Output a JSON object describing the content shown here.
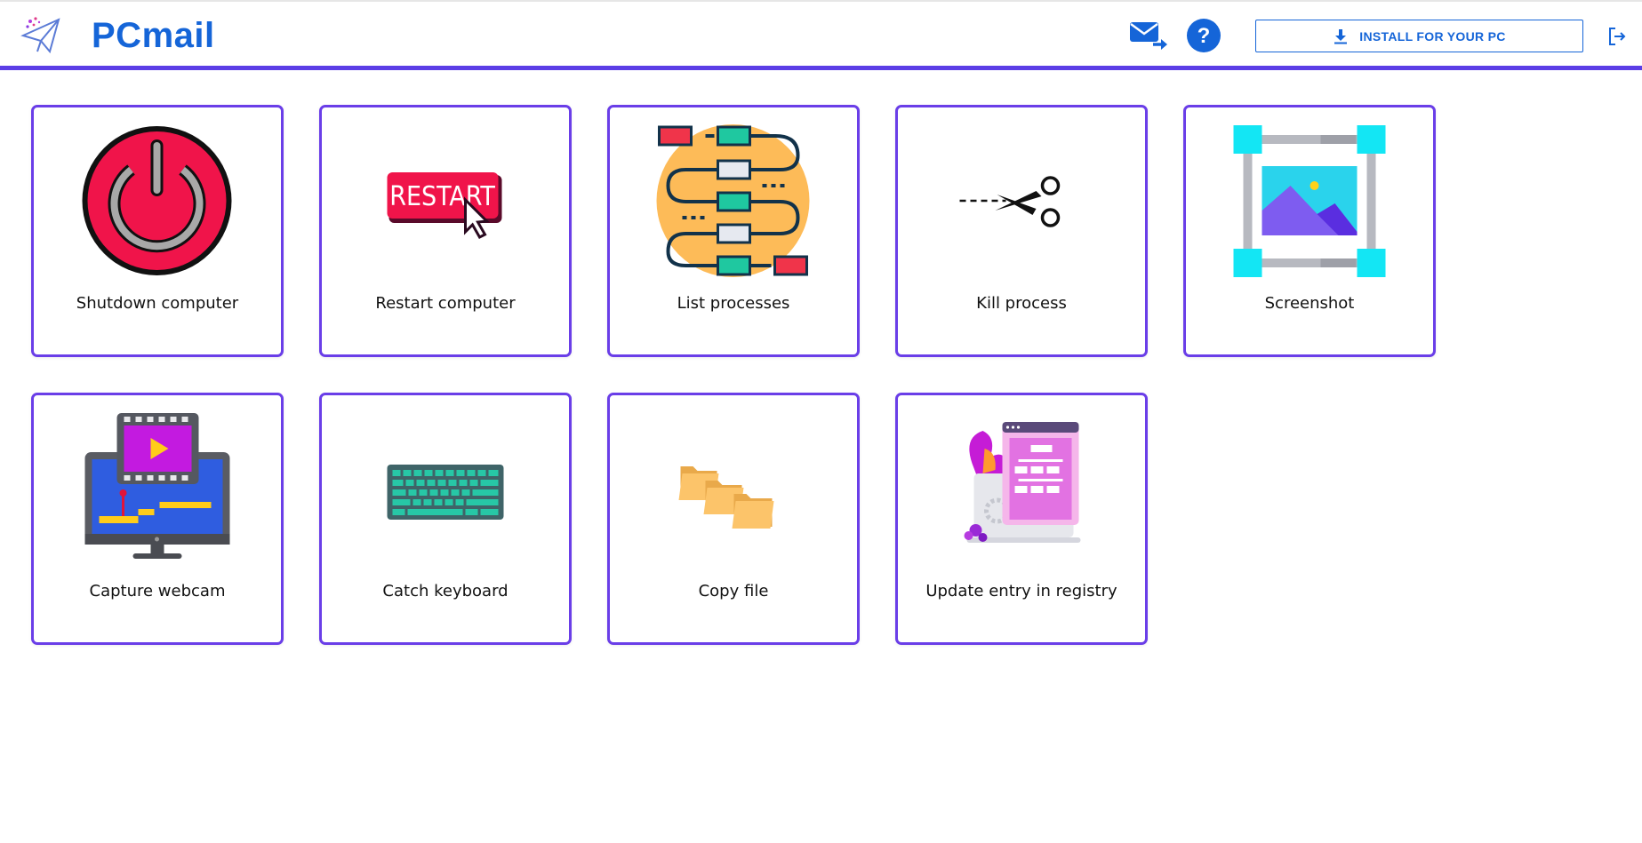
{
  "app": {
    "title": "PCmail",
    "install_label": "INSTALL FOR YOUR PC",
    "accent": "#5b3ee6",
    "brand_color": "#1565d8"
  },
  "header": {
    "icons": [
      "paper-plane-logo-icon",
      "mail-forward-icon",
      "help-icon",
      "download-icon",
      "logout-icon"
    ]
  },
  "actions": [
    {
      "label": "Shutdown computer",
      "icon": "power-icon"
    },
    {
      "label": "Restart computer",
      "icon": "restart-icon"
    },
    {
      "label": "List processes",
      "icon": "process-flow-icon"
    },
    {
      "label": "Kill process",
      "icon": "scissors-icon"
    },
    {
      "label": "Screenshot",
      "icon": "screenshot-icon"
    },
    {
      "label": "Capture webcam",
      "icon": "webcam-icon"
    },
    {
      "label": "Catch keyboard",
      "icon": "keyboard-icon"
    },
    {
      "label": "Copy file",
      "icon": "folders-icon"
    },
    {
      "label": "Update entry in registry",
      "icon": "registry-icon"
    }
  ]
}
